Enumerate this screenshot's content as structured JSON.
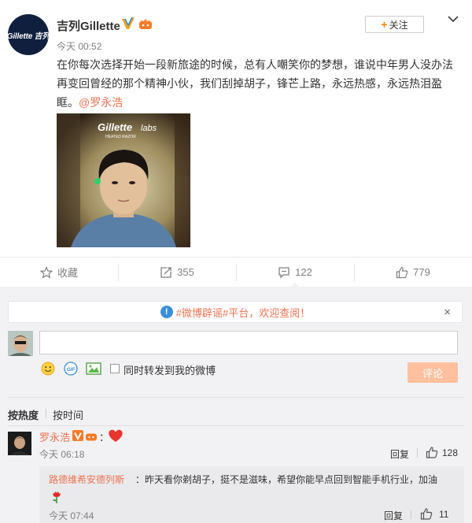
{
  "post": {
    "username": "吉列Gillette",
    "avatar_logo": "Gillette 吉列",
    "follow_label": "关注",
    "time": "今天 00:52",
    "text": "在你每次选择开始一段新旅途的时候，总有人嘲笑你的梦想，谁说中年男人没办法再变回曾经的那个精神小伙，我们刮掉胡子，锋芒上路，永远热感，永远热泪盈眶。",
    "mention": "@罗永浩",
    "image_brand": "Gillette",
    "image_brand_sub": "labs",
    "image_caption": "HEATED RAZOR"
  },
  "actions": {
    "favorite_label": "收藏",
    "repost_count": "355",
    "comment_count": "122",
    "like_count": "779"
  },
  "compose": {
    "notice_text": "#微博辟谣#平台，欢迎查阅！",
    "notice_close": "×",
    "repost_label": "同时转发到我的微博",
    "submit_label": "评论",
    "gif_label": "GIF"
  },
  "sort": {
    "hot_label": "按热度",
    "time_label": "按时间"
  },
  "comment": {
    "name": "罗永浩",
    "colon": "：",
    "time": "今天 06:18",
    "reply_label": "回复",
    "like_count": "128",
    "sub": {
      "name": "路德维希安德列斯",
      "text": "：昨天看你剃胡子，挺不是滋味，希望你能早点回到智能手机行业，加油",
      "time": "今天 07:44",
      "reply_label": "回复",
      "like_count": "11"
    }
  },
  "colors": {
    "accent": "#eb7350",
    "follow_plus": "#ff8200",
    "submit_disabled": "#ffc09f",
    "verified": "#2f8ce3"
  }
}
